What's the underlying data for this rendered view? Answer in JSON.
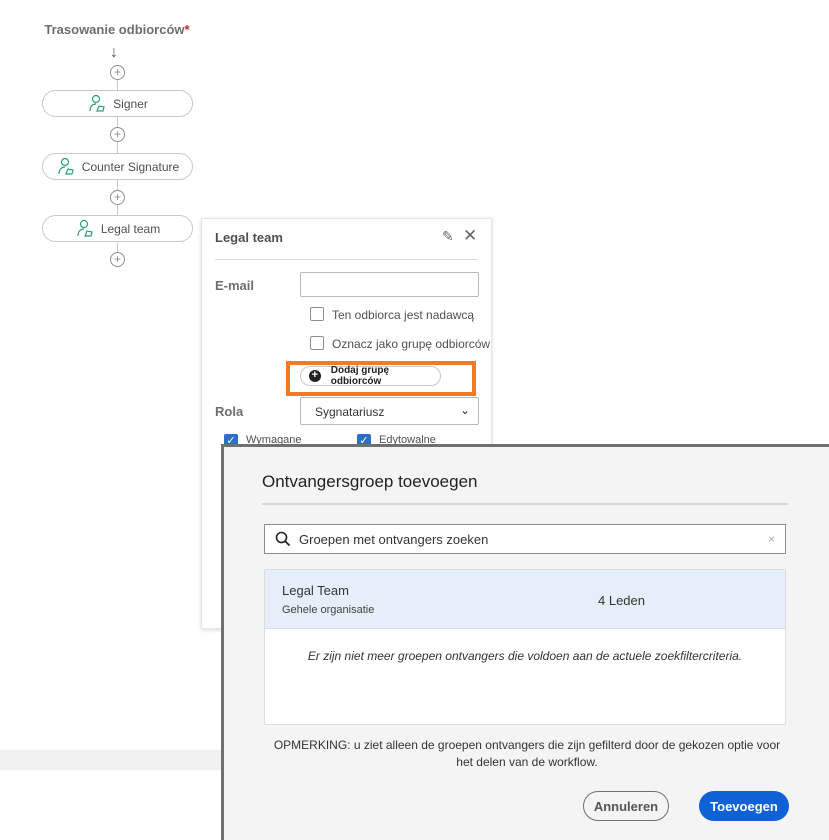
{
  "routing": {
    "title": "Trasowanie odbiorców",
    "required_mark": "*",
    "nodes": [
      {
        "label": "Signer"
      },
      {
        "label": "Counter Signature"
      },
      {
        "label": "Legal team"
      }
    ]
  },
  "panel": {
    "title": "Legal team",
    "email_label": "E-mail",
    "email_value": "",
    "checkbox_sender": "Ten odbiorca jest nadawcą",
    "checkbox_group": "Oznacz jako grupę odbiorców",
    "add_group_button": "Dodaj grupę odbiorców",
    "role_label": "Rola",
    "role_value": "Sygnatariusz",
    "required_label": "Wymagane",
    "editable_label": "Edytowalne",
    "highlight_color": "#f47920"
  },
  "modal": {
    "title": "Ontvangersgroep toevoegen",
    "search_placeholder": "Groepen met ontvangers zoeken",
    "groups": [
      {
        "name": "Legal Team",
        "scope": "Gehele organisatie",
        "members": "4 Leden"
      }
    ],
    "empty_message": "Er zijn niet meer groepen ontvangers die voldoen aan de actuele zoekfiltercriteria.",
    "note": "OPMERKING: u ziet alleen de groepen ontvangers die zijn gefilterd door de gekozen optie voor het delen van de workflow.",
    "cancel_label": "Annuleren",
    "add_label": "Toevoegen",
    "primary_color": "#0f62d6"
  }
}
